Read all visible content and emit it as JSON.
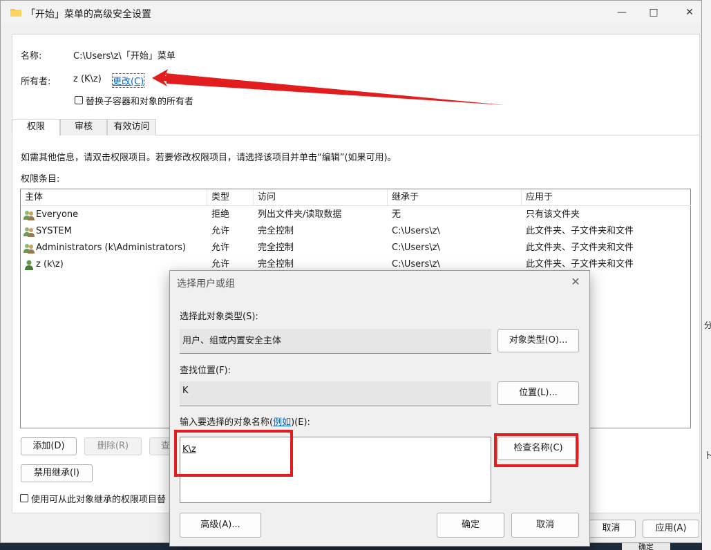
{
  "window": {
    "title": "「开始」菜单的高级安全设置",
    "minimize": "—",
    "maximize": "□",
    "close": "✕"
  },
  "info": {
    "name_label": "名称:",
    "name_value": "C:\\Users\\z\\「开始」菜单",
    "owner_label": "所有者:",
    "owner_value": "z (K\\z)",
    "change_link": "更改(C)",
    "replace_owner_checkbox": "替换子容器和对象的所有者"
  },
  "tabs": [
    {
      "label": "权限"
    },
    {
      "label": "审核"
    },
    {
      "label": "有效访问"
    }
  ],
  "hint_text": "如需其他信息，请双击权限项目。若要修改权限项目，请选择该项目并单击“编辑”(如果可用)。",
  "entries_label": "权限条目:",
  "table": {
    "headers": [
      "主体",
      "类型",
      "访问",
      "继承于",
      "应用于"
    ],
    "rows": [
      {
        "principal": "Everyone",
        "type": "拒绝",
        "access": "列出文件夹/读取数据",
        "inherited": "无",
        "applies": "只有该文件夹",
        "icon": "group-icon"
      },
      {
        "principal": "SYSTEM",
        "type": "允许",
        "access": "完全控制",
        "inherited": "C:\\Users\\z\\",
        "applies": "此文件夹、子文件夹和文件",
        "icon": "group-icon"
      },
      {
        "principal": "Administrators (k\\Administrators)",
        "type": "允许",
        "access": "完全控制",
        "inherited": "C:\\Users\\z\\",
        "applies": "此文件夹、子文件夹和文件",
        "icon": "group-icon"
      },
      {
        "principal": "z (k\\z)",
        "type": "允许",
        "access": "完全控制",
        "inherited": "C:\\Users\\z\\",
        "applies": "此文件夹、子文件夹和文件",
        "icon": "user-icon"
      }
    ]
  },
  "buttons": {
    "add": "添加(D)",
    "remove": "删除(R)",
    "view_partial": "查",
    "disable_inheritance": "禁用继承(I)",
    "inherit_checkbox": "使用可从此对象继承的权限项目替",
    "cancel": "取消",
    "apply": "应用(A)",
    "ok_peek": "确定"
  },
  "dialog": {
    "title": "选择用户或组",
    "close": "✕",
    "object_type_label": "选择此对象类型(S):",
    "object_type_value": "用户、组或内置安全主体",
    "object_type_button": "对象类型(O)...",
    "location_label": "查找位置(F):",
    "location_value": "K",
    "location_button": "位置(L)...",
    "names_label_prefix": "输入要选择的对象名称(",
    "names_label_link": "例如",
    "names_label_suffix": ")(E):",
    "names_value": "K\\z",
    "check_names_button": "检查名称(C)",
    "advanced_button": "高级(A)...",
    "ok_button": "确定",
    "cancel_button": "取消"
  },
  "background": {
    "frag1": "分",
    "frag2": "卜"
  },
  "colors": {
    "annotation_red": "#e21d1d",
    "link_blue": "#0066cc"
  }
}
